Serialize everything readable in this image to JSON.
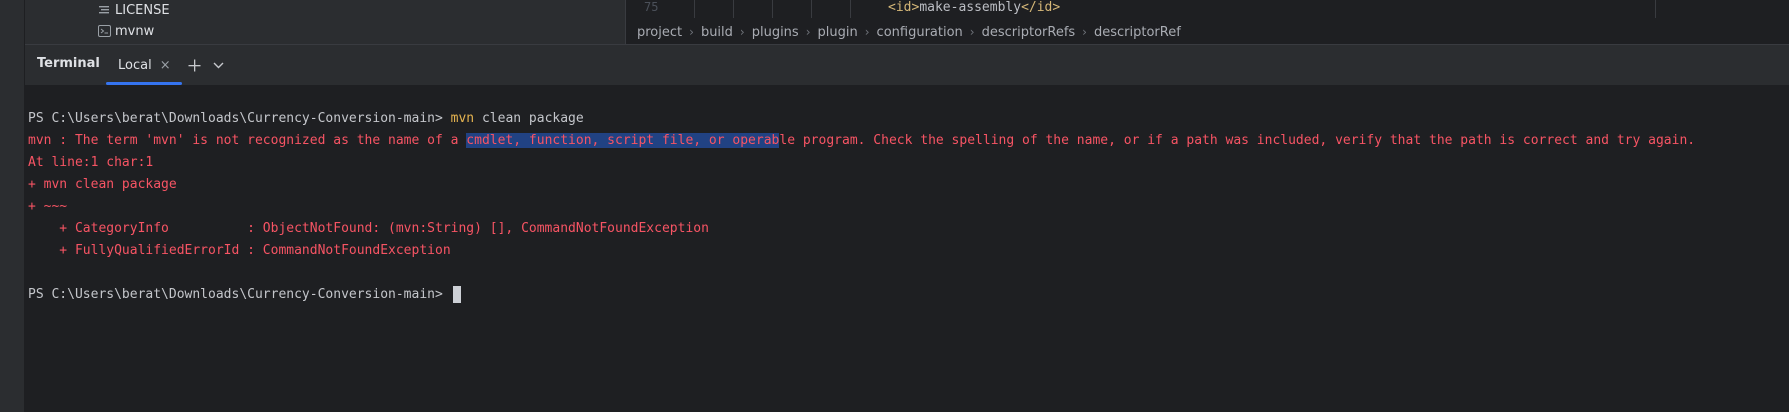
{
  "project_files": [
    {
      "name": "LICENSE",
      "icon": "text-file-icon"
    },
    {
      "name": "mvnw",
      "icon": "terminal-file-icon"
    }
  ],
  "editor": {
    "line_number": "75",
    "code_open_tag": "<id>",
    "code_value": "make-assembly",
    "code_close_tag": "</id>",
    "breadcrumbs": [
      "project",
      "build",
      "plugins",
      "plugin",
      "configuration",
      "descriptorRefs",
      "descriptorRef"
    ]
  },
  "terminal": {
    "title": "Terminal",
    "tab_label": "Local",
    "prompt": "PS C:\\Users\\berat\\Downloads\\Currency-Conversion-main>",
    "command_word": "mvn",
    "command_rest": " clean package",
    "error_line1_pre": "mvn : The term 'mvn' is not recognized as the name of a ",
    "error_line1_selected": "cmdlet, function, script file, or operab",
    "error_line1_post": "le program. Check the spelling of the name, or if a path was included, verify that the path is correct and try again.",
    "error_line2": "At line:1 char:1",
    "error_line3": "+ mvn clean package",
    "error_line4": "+ ~~~",
    "error_line5": "    + CategoryInfo          : ObjectNotFound: (mvn:String) [], CommandNotFoundException",
    "error_line6": "    + FullyQualifiedErrorId : CommandNotFoundException",
    "final_prompt": "PS C:\\Users\\berat\\Downloads\\Currency-Conversion-main>"
  },
  "colors": {
    "background": "#1e1f22",
    "error": "#f75464",
    "command_highlight": "#e6b450",
    "selection": "#214283",
    "accent": "#3574f0"
  }
}
